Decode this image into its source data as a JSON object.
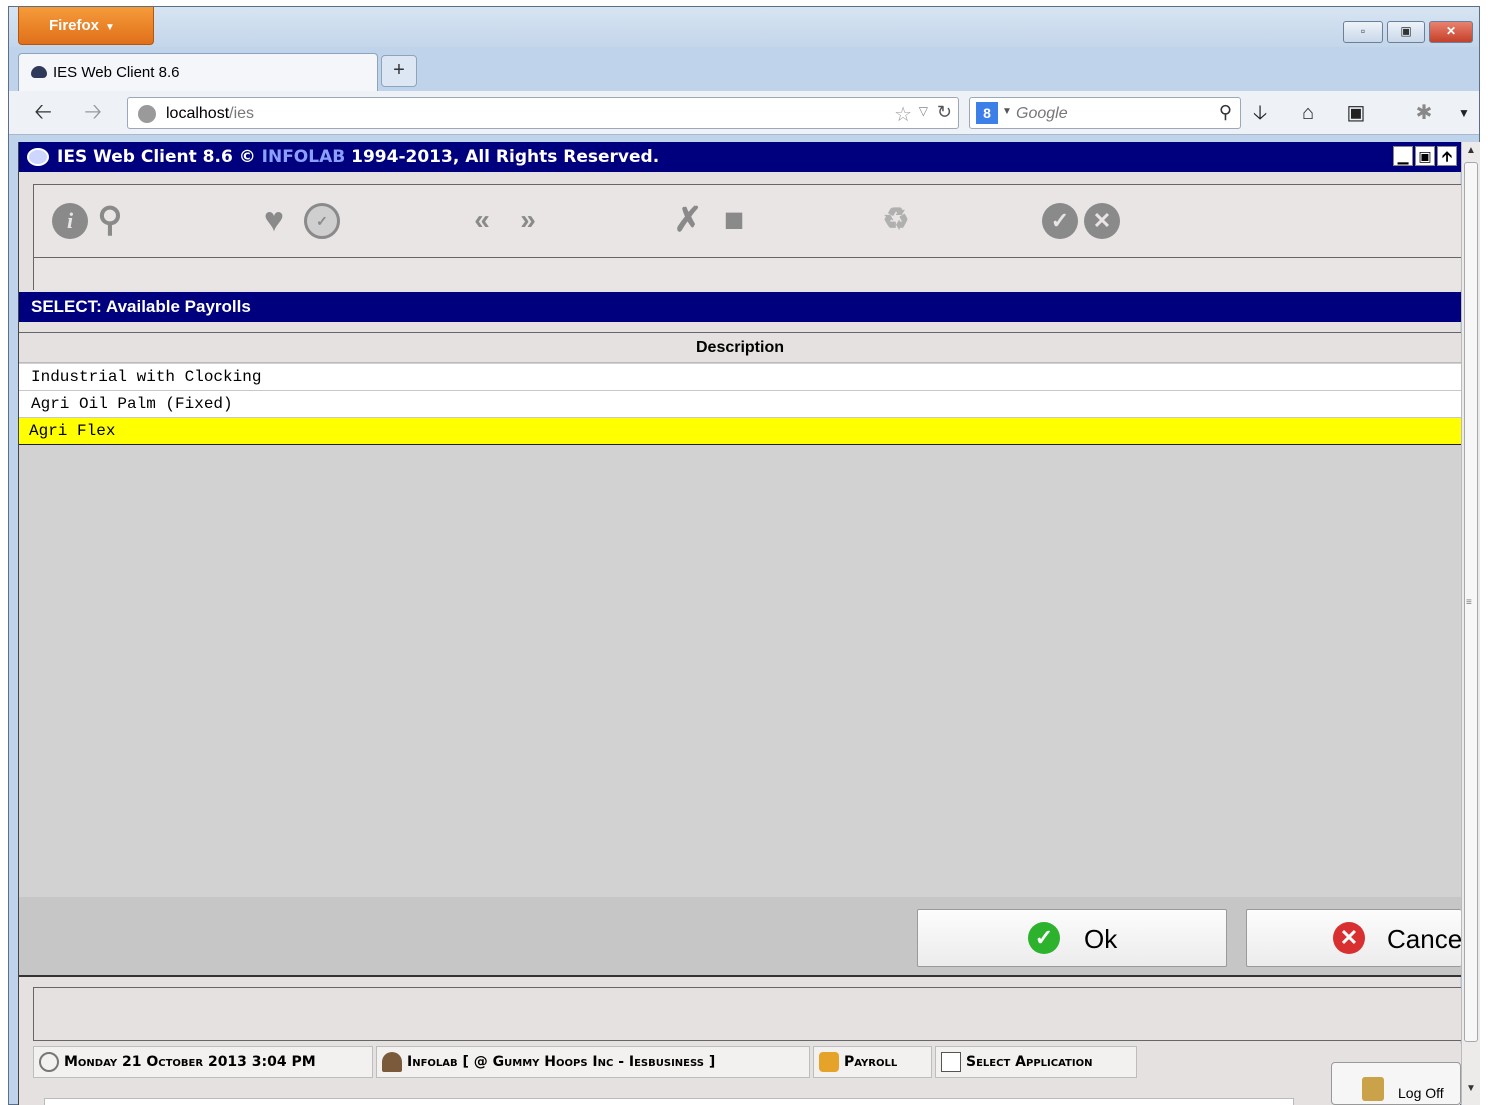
{
  "browser": {
    "menu_label": "Firefox",
    "tab_title": "IES Web Client 8.6",
    "new_tab": "+",
    "url_host": "localhost",
    "url_path": "/ies",
    "search_engine_glyph": "8",
    "search_placeholder": "Google",
    "window_controls": [
      "minimize",
      "restore",
      "close"
    ]
  },
  "app": {
    "title_main": "IES Web Client 8.6 ©",
    "title_brand": "INFOLAB",
    "title_rest": "1994-2013, All Rights Reserved.",
    "toolbar_icons": [
      "info-icon",
      "search-icon",
      "heart-icon",
      "clock-icon",
      "previous-icon",
      "next-icon",
      "tools-icon",
      "stop-icon",
      "recycle-icon",
      "accept-icon",
      "cancel-icon"
    ]
  },
  "select_dialog": {
    "header": "SELECT: Available Payrolls",
    "column_header": "Description",
    "rows": [
      {
        "description": "Industrial with Clocking",
        "selected": false
      },
      {
        "description": "Agri Oil Palm (Fixed)",
        "selected": false
      },
      {
        "description": "Agri Flex",
        "selected": true
      }
    ],
    "ok_label": "Ok",
    "cancel_label": "Cance"
  },
  "status_bar": {
    "datetime": "Monday 21 October 2013 3:04 PM",
    "user": "Infolab [ @ Gummy Hoops Inc - Iesbusiness ]",
    "module": "Payroll",
    "action": "Select Application"
  },
  "logoff_label": "Log Off",
  "colors": {
    "title_bar": "#00007f",
    "selected_row": "#ffff00",
    "ok_icon": "#2db22d",
    "cancel_icon": "#d83030",
    "firefox_orange": "#e57a20"
  }
}
